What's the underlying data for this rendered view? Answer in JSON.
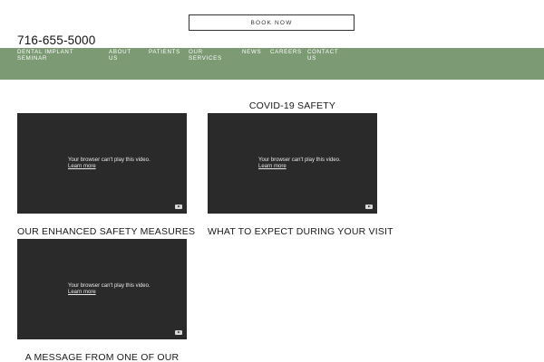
{
  "header": {
    "book_label": "BOOK NOW",
    "phone": "716-655-5000"
  },
  "nav": {
    "items": [
      {
        "line1": "DENTAL IMPLANT",
        "line2": "SEMINAR"
      },
      {
        "line1": "ABOUT",
        "line2": "US"
      },
      {
        "line1": "PATIENTS",
        "line2": ""
      },
      {
        "line1": "OUR",
        "line2": "SERVICES"
      },
      {
        "line1": "NEWS",
        "line2": ""
      },
      {
        "line1": "CAREERS",
        "line2": ""
      },
      {
        "line1": "CONTACT",
        "line2": "US"
      }
    ],
    "bg_color": "#7c9a73"
  },
  "sections": {
    "covid_title": "COVID-19 SAFETY",
    "enhanced_title": "OUR ENHANCED SAFETY MEASURES",
    "expect_title": "WHAT TO EXPECT DURING YOUR VISIT",
    "message_title": "A MESSAGE FROM ONE OF OUR"
  },
  "video": {
    "message": "Your browser can't play this video.",
    "link": "Learn more",
    "icon": "youtube-icon"
  }
}
